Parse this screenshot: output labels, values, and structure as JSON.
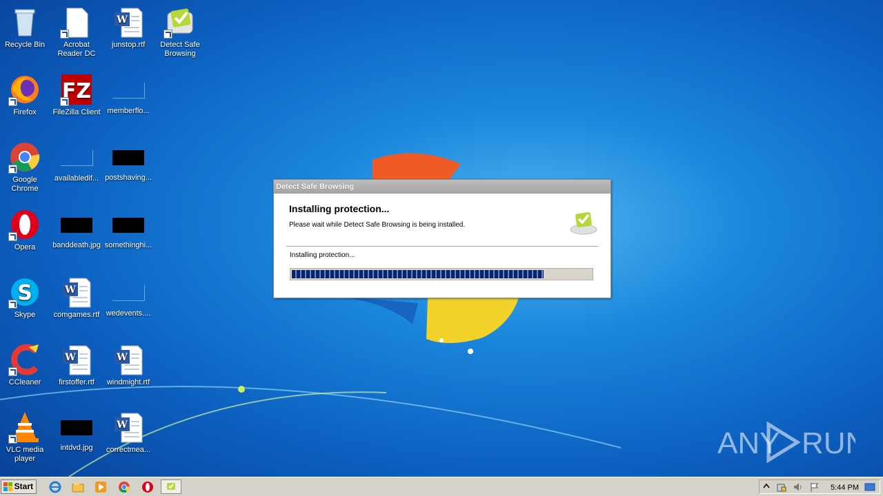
{
  "desktop": {
    "icons": [
      {
        "label": "Recycle Bin"
      },
      {
        "label": "Acrobat Reader DC"
      },
      {
        "label": "junstop.rtf"
      },
      {
        "label": "Detect Safe Browsing"
      },
      {
        "label": "Firefox"
      },
      {
        "label": "FileZilla Client"
      },
      {
        "label": "memberflo..."
      },
      {
        "label": "Google Chrome"
      },
      {
        "label": "availabledif..."
      },
      {
        "label": "postshaving..."
      },
      {
        "label": "Opera"
      },
      {
        "label": "banddeath.jpg"
      },
      {
        "label": "somethinghi..."
      },
      {
        "label": "Skype"
      },
      {
        "label": "comgames.rtf"
      },
      {
        "label": "wedevents...."
      },
      {
        "label": "CCleaner"
      },
      {
        "label": "firstoffer.rtf"
      },
      {
        "label": "windmight.rtf"
      },
      {
        "label": "VLC media player"
      },
      {
        "label": "intdvd.jpg"
      },
      {
        "label": "correctmea..."
      }
    ]
  },
  "dialog": {
    "title": "Detect Safe Browsing",
    "heading": "Installing protection...",
    "subtitle": "Please wait while Detect Safe Browsing is being installed.",
    "status": "Installing protection...",
    "progress_percent": 84
  },
  "taskbar": {
    "start_label": "Start",
    "clock": "5:44 PM"
  },
  "watermark": {
    "text_left": "ANY",
    "text_right": "RUN"
  },
  "colors": {
    "progress": "#0a246a",
    "accent": "#1a86dc"
  }
}
